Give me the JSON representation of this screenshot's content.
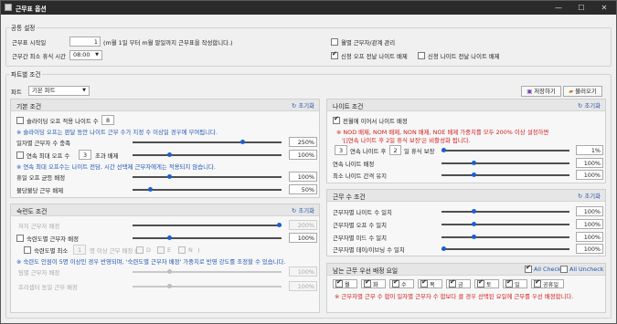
{
  "window": {
    "title": "근무표 옵션",
    "min_icon": "minimize-icon",
    "max_icon": "maximize-icon",
    "close_icon": "close-icon",
    "min": "—",
    "max": "☐",
    "close": "✕"
  },
  "common": {
    "title": "공통 설정",
    "start_label": "근무표 시작일",
    "start_value": "1",
    "start_desc": "(m월 1일 부터 m월 말일까지 근무표을 작성합니다.)",
    "rest_label": "근무간 최소 휴식 시간",
    "rest_value": "08:00",
    "monthly_label": "월별 근무자/관계 관리",
    "prev_night_label": "신청 오프 전날 나이트 배제",
    "prev_night2_label": "신청 나이트 전날 나이트 배제"
  },
  "part": {
    "title": "파트별 조건",
    "part_label": "파트",
    "part_value": "기본 파트",
    "save_label": "저장하기",
    "load_label": "불러오기"
  },
  "basic": {
    "title": "기본 조건",
    "reset": "초기화",
    "slide_label": "슬라이딩 오프 적용 나이트 수",
    "slide_value": "8",
    "slide_note": "※ 슬라이딩 오프는 판달 동안 나이트 근무 수가 지정 수 이상일 경우에 부여됩니다.",
    "daily_label": "일자별 근무자 수 충족",
    "daily_value": "250%",
    "consec_label": "연속 최대 오프 수",
    "consec_value": "3",
    "consec_suffix": "초과 배제",
    "consec_pct": "100%",
    "consec_note": "※ 연속 최대 오프수는 나이트 전담, 시간 선택제 근무자에게는 적용되지 않습니다.",
    "holiday_label": "휴일 오프 균등 배정",
    "holiday_value": "100%",
    "weekend_label": "불당불당 근무 배제",
    "weekend_value": "50%"
  },
  "skill": {
    "title": "숙련도 조건",
    "reset": "초기화",
    "staff_label": "저지 근무자 배정",
    "staff_value": "200%",
    "skilled_label": "숙련도별 근무자 배정",
    "skilled_value": "100%",
    "skilled_min": "숙련도별 최소",
    "skilled_min_value": "1",
    "skilled_min_suffix": "명 이상 근무 배정 (",
    "d": "D",
    "e": "E",
    "n": "N",
    "close_paren": ")",
    "skill_note": "※ 숙련도 인원이 5명 이상인 경우 반영되며, '숙련도별 근무자 배정' 가중치로 반영 강도를 조정할 수 있습니다.",
    "newbie_label": "팀별 근무자 배정",
    "newbie_value": "100%",
    "preceptor_label": "프리셉터 동일 근무 배정",
    "preceptor_value": "100%"
  },
  "night": {
    "title": "나이트 조건",
    "reset": "초기화",
    "prev_label": "전월에 이어서 나이트 배정",
    "note1": "※ NOD 배제, NOM 배제, NON 배제, NOE 배제 가중치를 모두 200% 이상 설정하면",
    "note2": "'[]연속 나이트 후 2일 휴식 보장'은 비활성화 됩니다.",
    "guarantee_value": "3",
    "guarantee_text": "연속 나이트 후",
    "guarantee_days": "2",
    "guarantee_suffix": "일 휴식 보장",
    "guarantee_pct": "1%",
    "consec_label": "연속 나이트 배정",
    "consec_value": "100%",
    "interval_label": "최소 나이트 간격 유지",
    "interval_value": "100%"
  },
  "work": {
    "title": "근무 수 조건",
    "reset": "초기화",
    "night_label": "근무자별 나이트 수 일치",
    "night_value": "100%",
    "off_label": "근무자별 오프 수 일치",
    "off_value": "100%",
    "mid_label": "근무자별 미드 수 일치",
    "mid_value": "100%",
    "day_label": "근무자별 데이/이브닝 수 일치",
    "day_value": "100%"
  },
  "pref": {
    "title": "남는 근무 우선 배정 요일",
    "all_check": "All Check",
    "all_uncheck": "All Uncheck",
    "days": [
      "월",
      "화",
      "수",
      "목",
      "금",
      "토",
      "일",
      "공휴일"
    ],
    "note": "※ 근무자별 근무 수 합이 일자별 근무자 수 합보다 클 경우 선택된 요일에 근무를 우선 배정합니다."
  }
}
